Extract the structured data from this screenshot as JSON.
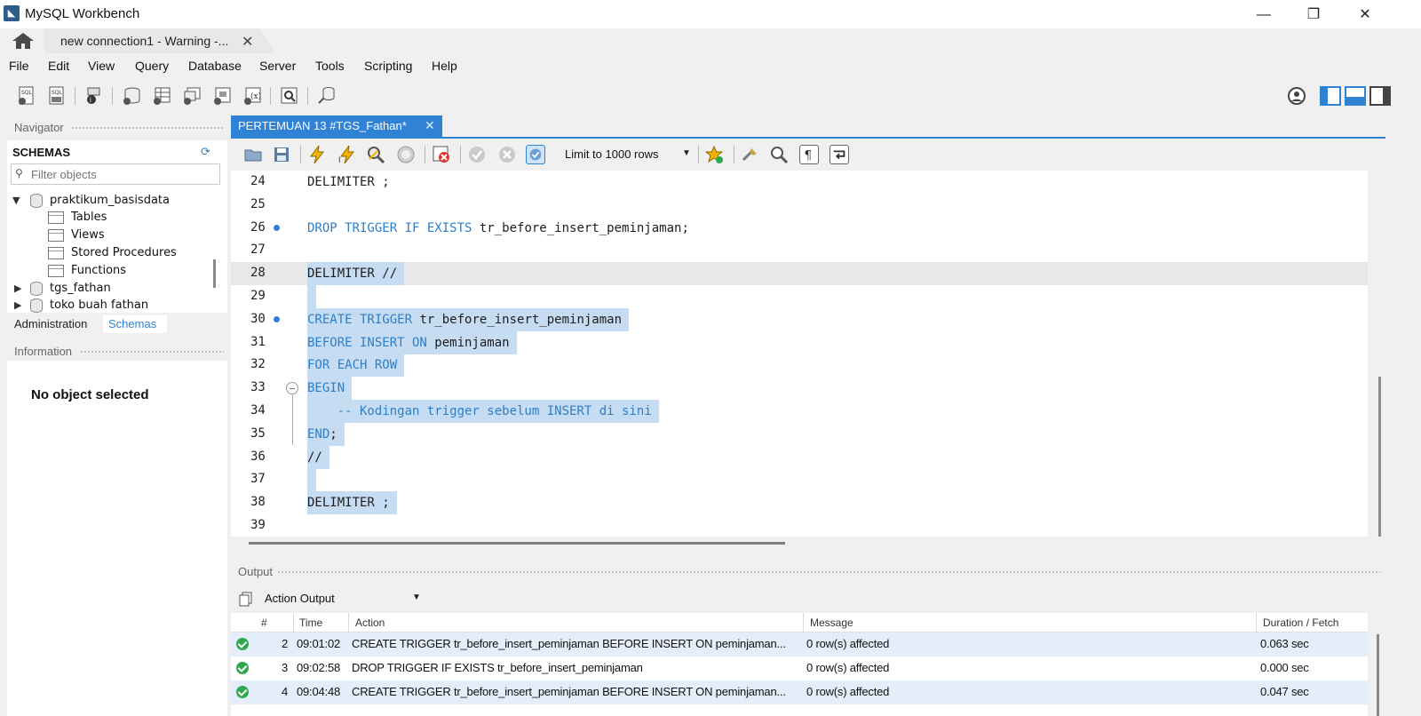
{
  "window": {
    "title": "MySQL Workbench"
  },
  "tabs": {
    "connection_label": "new connection1 - Warning -..."
  },
  "menu": [
    "File",
    "Edit",
    "View",
    "Query",
    "Database",
    "Server",
    "Tools",
    "Scripting",
    "Help"
  ],
  "navigator": {
    "title": "Navigator",
    "schemas_title": "SCHEMAS",
    "filter_placeholder": "Filter objects",
    "tree": [
      {
        "label": "praktikum_basisdata",
        "expanded": true
      },
      {
        "label": "Tables"
      },
      {
        "label": "Views"
      },
      {
        "label": "Stored Procedures"
      },
      {
        "label": "Functions"
      },
      {
        "label": "tgs_fathan",
        "expanded": false
      },
      {
        "label": "toko buah fathan",
        "expanded": false
      }
    ],
    "bottom_tabs": [
      "Administration",
      "Schemas"
    ],
    "active_bottom_tab": "Schemas"
  },
  "information": {
    "title": "Information",
    "empty_text": "No object selected"
  },
  "editor": {
    "file_tab": "PERTEMUAN 13 #TGS_Fathan*",
    "limit_label": "Limit to 1000 rows",
    "lines": [
      {
        "n": "24",
        "parts": [
          [
            "DELIMITER ;",
            "p"
          ]
        ]
      },
      {
        "n": "25",
        "parts": []
      },
      {
        "n": "26",
        "parts": [
          [
            "DROP TRIGGER IF EXISTS",
            "k"
          ],
          [
            " tr_before_insert_peminjaman;",
            "p"
          ]
        ]
      },
      {
        "n": "27",
        "parts": []
      },
      {
        "n": "28",
        "parts": [
          [
            "DELIMITER //",
            "p"
          ]
        ]
      },
      {
        "n": "29",
        "parts": []
      },
      {
        "n": "30",
        "parts": [
          [
            "CREATE TRIGGER",
            "k"
          ],
          [
            " tr_before_insert_peminjaman",
            "p"
          ]
        ]
      },
      {
        "n": "31",
        "parts": [
          [
            "BEFORE INSERT ON",
            "k"
          ],
          [
            " peminjaman",
            "p"
          ]
        ]
      },
      {
        "n": "32",
        "parts": [
          [
            "FOR EACH ROW",
            "k"
          ]
        ]
      },
      {
        "n": "33",
        "parts": [
          [
            "BEGIN",
            "k"
          ]
        ]
      },
      {
        "n": "34",
        "parts": [
          [
            "    -- Kodingan trigger sebelum INSERT di sini",
            "c"
          ]
        ]
      },
      {
        "n": "35",
        "parts": [
          [
            "END",
            "k"
          ],
          [
            ";",
            "p"
          ]
        ]
      },
      {
        "n": "36",
        "parts": [
          [
            "//",
            "p"
          ]
        ]
      },
      {
        "n": "37",
        "parts": []
      },
      {
        "n": "38",
        "parts": [
          [
            "DELIMITER ;",
            "p"
          ]
        ]
      },
      {
        "n": "39",
        "parts": []
      }
    ]
  },
  "output": {
    "title": "Output",
    "selector_label": "Action Output",
    "columns": [
      "#",
      "Time",
      "Action",
      "Message",
      "Duration / Fetch"
    ],
    "rows": [
      {
        "num": "2",
        "time": "09:01:02",
        "action": "CREATE TRIGGER tr_before_insert_peminjaman BEFORE INSERT ON peminjaman...",
        "message": "0 row(s) affected",
        "duration": "0.063 sec"
      },
      {
        "num": "3",
        "time": "09:02:58",
        "action": "DROP TRIGGER IF EXISTS tr_before_insert_peminjaman",
        "message": "0 row(s) affected",
        "duration": "0.000 sec"
      },
      {
        "num": "4",
        "time": "09:04:48",
        "action": "CREATE TRIGGER tr_before_insert_peminjaman BEFORE INSERT ON peminjaman...",
        "message": "0 row(s) affected",
        "duration": "0.047 sec"
      }
    ]
  },
  "colors": {
    "accent": "#2f82d4",
    "keyword": "#2f7fc6",
    "selection": "#c5dcf3",
    "success": "#2fa84f"
  }
}
